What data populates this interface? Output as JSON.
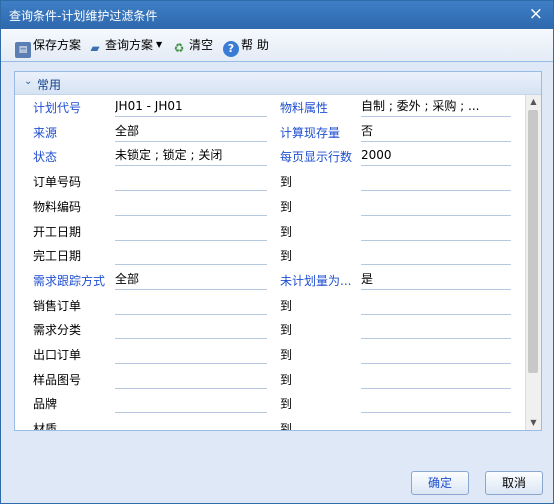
{
  "dialog": {
    "title": "查询条件-计划维护过滤条件",
    "close_glyph": "×"
  },
  "toolbar": {
    "save_label": "保存方案",
    "query_label": "查询方案",
    "clear_label": "清空",
    "help_label": "帮 助"
  },
  "section": {
    "title": "常用"
  },
  "rows": [
    {
      "label": "计划代号",
      "value": "JH01 - JH01",
      "right_label": "物料属性",
      "right_value": "自制 ; 委外 ; 采购 ; ..."
    },
    {
      "label": "来源",
      "value": "全部",
      "right_label": "计算现存量",
      "right_value": "否"
    },
    {
      "label": "状态",
      "value": "未锁定 ; 锁定 ; 关闭",
      "right_label": "每页显示行数",
      "right_value": "2000"
    },
    {
      "label": "订单号码",
      "value": "",
      "right_label": "到",
      "right_value": ""
    },
    {
      "label": "物料编码",
      "value": "",
      "right_label": "到",
      "right_value": ""
    },
    {
      "label": "开工日期",
      "value": "",
      "right_label": "到",
      "right_value": ""
    },
    {
      "label": "完工日期",
      "value": "",
      "right_label": "到",
      "right_value": ""
    },
    {
      "label": "需求跟踪方式",
      "value": "全部",
      "right_label": "未计划量为...",
      "right_value": "是"
    },
    {
      "label": "销售订单",
      "value": "",
      "right_label": "到",
      "right_value": ""
    },
    {
      "label": "需求分类",
      "value": "",
      "right_label": "到",
      "right_value": ""
    },
    {
      "label": "出口订单",
      "value": "",
      "right_label": "到",
      "right_value": ""
    },
    {
      "label": "样品图号",
      "value": "",
      "right_label": "到",
      "right_value": ""
    },
    {
      "label": "品牌",
      "value": "",
      "right_label": "到",
      "right_value": ""
    },
    {
      "label": "材质",
      "value": "",
      "right_label": "到",
      "right_value": ""
    }
  ],
  "buttons": {
    "ok": "确定",
    "cancel": "取消"
  },
  "colors": {
    "title_bar": "#2e68ad",
    "label_blue": "#1f4fd1",
    "dialog_bg": "#dfe8f6"
  }
}
